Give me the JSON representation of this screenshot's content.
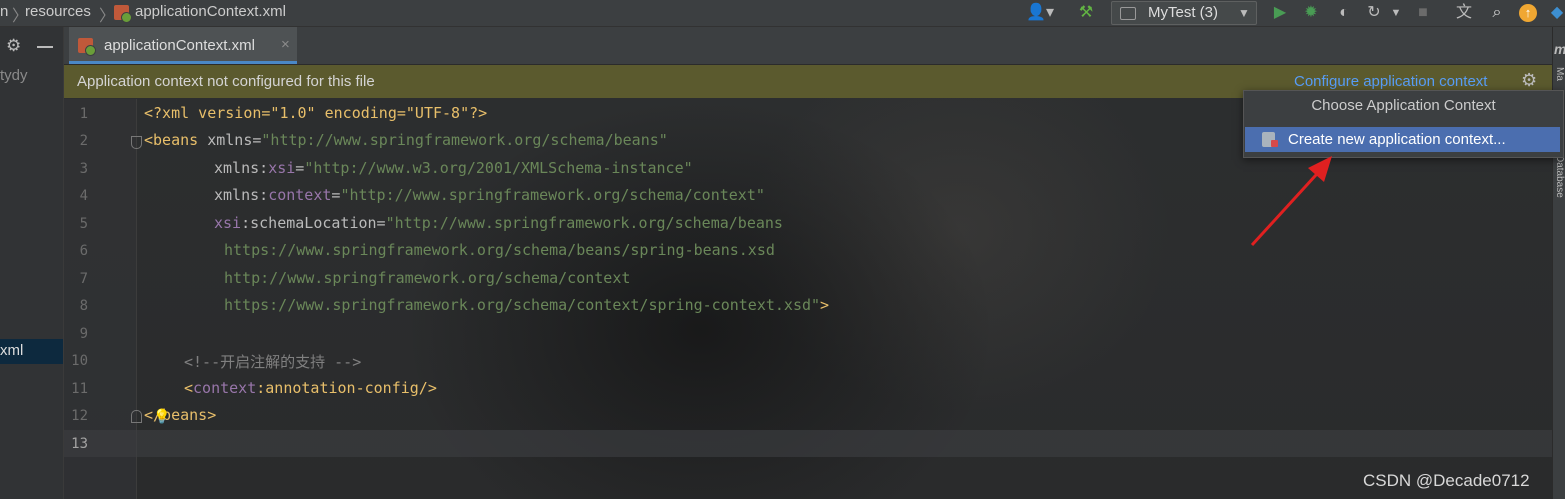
{
  "navbar": {
    "crumb_cut": "n",
    "crumb_resources": "resources",
    "crumb_file": "applicationContext.xml",
    "run_config": "MyTest (3)"
  },
  "project_panel": {
    "partial_item_top": "tydy",
    "partial_item_selected": "xml"
  },
  "editor_tab": {
    "label": "applicationContext.xml",
    "close": "×"
  },
  "banner": {
    "message": "Application context not configured for this file",
    "link": "Configure application context"
  },
  "popup": {
    "title": "Choose Application Context",
    "item": "Create new application context..."
  },
  "right_strip_labels": [
    "m",
    "Ma",
    "Database"
  ],
  "line_numbers": [
    "1",
    "2",
    "3",
    "4",
    "5",
    "6",
    "7",
    "8",
    "9",
    "10",
    "11",
    "12",
    "13"
  ],
  "code": {
    "l1": "<?xml version=\"1.0\" encoding=\"UTF-8\"?>",
    "l2_tag": "<beans",
    "l2_attr": " xmlns=",
    "l2_val": "\"http://www.springframework.org/schema/beans\"",
    "l3_attr": "xmlns:",
    "l3_ns": "xsi",
    "l3_eq": "=",
    "l3_val": "\"http://www.w3.org/2001/XMLSchema-instance\"",
    "l4_attr": "xmlns:",
    "l4_ns": "context",
    "l4_eq": "=",
    "l4_val": "\"http://www.springframework.org/schema/context\"",
    "l5_ns": "xsi",
    "l5_attr": ":schemaLocation=",
    "l5_val": "\"http://www.springframework.org/schema/beans",
    "l6": "https://www.springframework.org/schema/beans/spring-beans.xsd",
    "l7": "http://www.springframework.org/schema/context",
    "l8_val": "https://www.springframework.org/schema/context/spring-context.xsd\"",
    "l8_end": ">",
    "l10": "<!--开启注解的支持 -->",
    "l11_open": "<",
    "l11_ns": "context",
    "l11_rest": ":annotation-config/>",
    "l12": "</beans>"
  },
  "watermark": "CSDN @Decade0712",
  "colors": {
    "banner_bg": "#5b5a2e",
    "link": "#589df6",
    "popup_selected": "#4b6eaf",
    "xml_tag": "#e8bf6a",
    "xml_string": "#6a8759",
    "xml_ns": "#9876aa"
  }
}
